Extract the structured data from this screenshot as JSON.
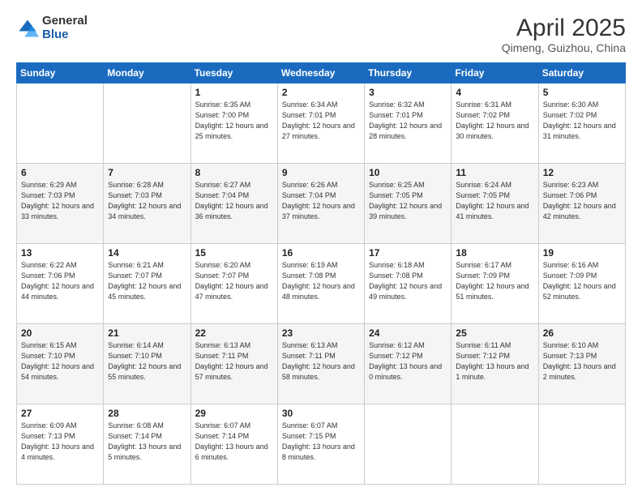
{
  "header": {
    "logo_general": "General",
    "logo_blue": "Blue",
    "month_year": "April 2025",
    "location": "Qimeng, Guizhou, China"
  },
  "weekdays": [
    "Sunday",
    "Monday",
    "Tuesday",
    "Wednesday",
    "Thursday",
    "Friday",
    "Saturday"
  ],
  "weeks": [
    [
      {
        "day": "",
        "info": ""
      },
      {
        "day": "",
        "info": ""
      },
      {
        "day": "1",
        "info": "Sunrise: 6:35 AM\nSunset: 7:00 PM\nDaylight: 12 hours and 25 minutes."
      },
      {
        "day": "2",
        "info": "Sunrise: 6:34 AM\nSunset: 7:01 PM\nDaylight: 12 hours and 27 minutes."
      },
      {
        "day": "3",
        "info": "Sunrise: 6:32 AM\nSunset: 7:01 PM\nDaylight: 12 hours and 28 minutes."
      },
      {
        "day": "4",
        "info": "Sunrise: 6:31 AM\nSunset: 7:02 PM\nDaylight: 12 hours and 30 minutes."
      },
      {
        "day": "5",
        "info": "Sunrise: 6:30 AM\nSunset: 7:02 PM\nDaylight: 12 hours and 31 minutes."
      }
    ],
    [
      {
        "day": "6",
        "info": "Sunrise: 6:29 AM\nSunset: 7:03 PM\nDaylight: 12 hours and 33 minutes."
      },
      {
        "day": "7",
        "info": "Sunrise: 6:28 AM\nSunset: 7:03 PM\nDaylight: 12 hours and 34 minutes."
      },
      {
        "day": "8",
        "info": "Sunrise: 6:27 AM\nSunset: 7:04 PM\nDaylight: 12 hours and 36 minutes."
      },
      {
        "day": "9",
        "info": "Sunrise: 6:26 AM\nSunset: 7:04 PM\nDaylight: 12 hours and 37 minutes."
      },
      {
        "day": "10",
        "info": "Sunrise: 6:25 AM\nSunset: 7:05 PM\nDaylight: 12 hours and 39 minutes."
      },
      {
        "day": "11",
        "info": "Sunrise: 6:24 AM\nSunset: 7:05 PM\nDaylight: 12 hours and 41 minutes."
      },
      {
        "day": "12",
        "info": "Sunrise: 6:23 AM\nSunset: 7:06 PM\nDaylight: 12 hours and 42 minutes."
      }
    ],
    [
      {
        "day": "13",
        "info": "Sunrise: 6:22 AM\nSunset: 7:06 PM\nDaylight: 12 hours and 44 minutes."
      },
      {
        "day": "14",
        "info": "Sunrise: 6:21 AM\nSunset: 7:07 PM\nDaylight: 12 hours and 45 minutes."
      },
      {
        "day": "15",
        "info": "Sunrise: 6:20 AM\nSunset: 7:07 PM\nDaylight: 12 hours and 47 minutes."
      },
      {
        "day": "16",
        "info": "Sunrise: 6:19 AM\nSunset: 7:08 PM\nDaylight: 12 hours and 48 minutes."
      },
      {
        "day": "17",
        "info": "Sunrise: 6:18 AM\nSunset: 7:08 PM\nDaylight: 12 hours and 49 minutes."
      },
      {
        "day": "18",
        "info": "Sunrise: 6:17 AM\nSunset: 7:09 PM\nDaylight: 12 hours and 51 minutes."
      },
      {
        "day": "19",
        "info": "Sunrise: 6:16 AM\nSunset: 7:09 PM\nDaylight: 12 hours and 52 minutes."
      }
    ],
    [
      {
        "day": "20",
        "info": "Sunrise: 6:15 AM\nSunset: 7:10 PM\nDaylight: 12 hours and 54 minutes."
      },
      {
        "day": "21",
        "info": "Sunrise: 6:14 AM\nSunset: 7:10 PM\nDaylight: 12 hours and 55 minutes."
      },
      {
        "day": "22",
        "info": "Sunrise: 6:13 AM\nSunset: 7:11 PM\nDaylight: 12 hours and 57 minutes."
      },
      {
        "day": "23",
        "info": "Sunrise: 6:13 AM\nSunset: 7:11 PM\nDaylight: 12 hours and 58 minutes."
      },
      {
        "day": "24",
        "info": "Sunrise: 6:12 AM\nSunset: 7:12 PM\nDaylight: 13 hours and 0 minutes."
      },
      {
        "day": "25",
        "info": "Sunrise: 6:11 AM\nSunset: 7:12 PM\nDaylight: 13 hours and 1 minute."
      },
      {
        "day": "26",
        "info": "Sunrise: 6:10 AM\nSunset: 7:13 PM\nDaylight: 13 hours and 2 minutes."
      }
    ],
    [
      {
        "day": "27",
        "info": "Sunrise: 6:09 AM\nSunset: 7:13 PM\nDaylight: 13 hours and 4 minutes."
      },
      {
        "day": "28",
        "info": "Sunrise: 6:08 AM\nSunset: 7:14 PM\nDaylight: 13 hours and 5 minutes."
      },
      {
        "day": "29",
        "info": "Sunrise: 6:07 AM\nSunset: 7:14 PM\nDaylight: 13 hours and 6 minutes."
      },
      {
        "day": "30",
        "info": "Sunrise: 6:07 AM\nSunset: 7:15 PM\nDaylight: 13 hours and 8 minutes."
      },
      {
        "day": "",
        "info": ""
      },
      {
        "day": "",
        "info": ""
      },
      {
        "day": "",
        "info": ""
      }
    ]
  ]
}
